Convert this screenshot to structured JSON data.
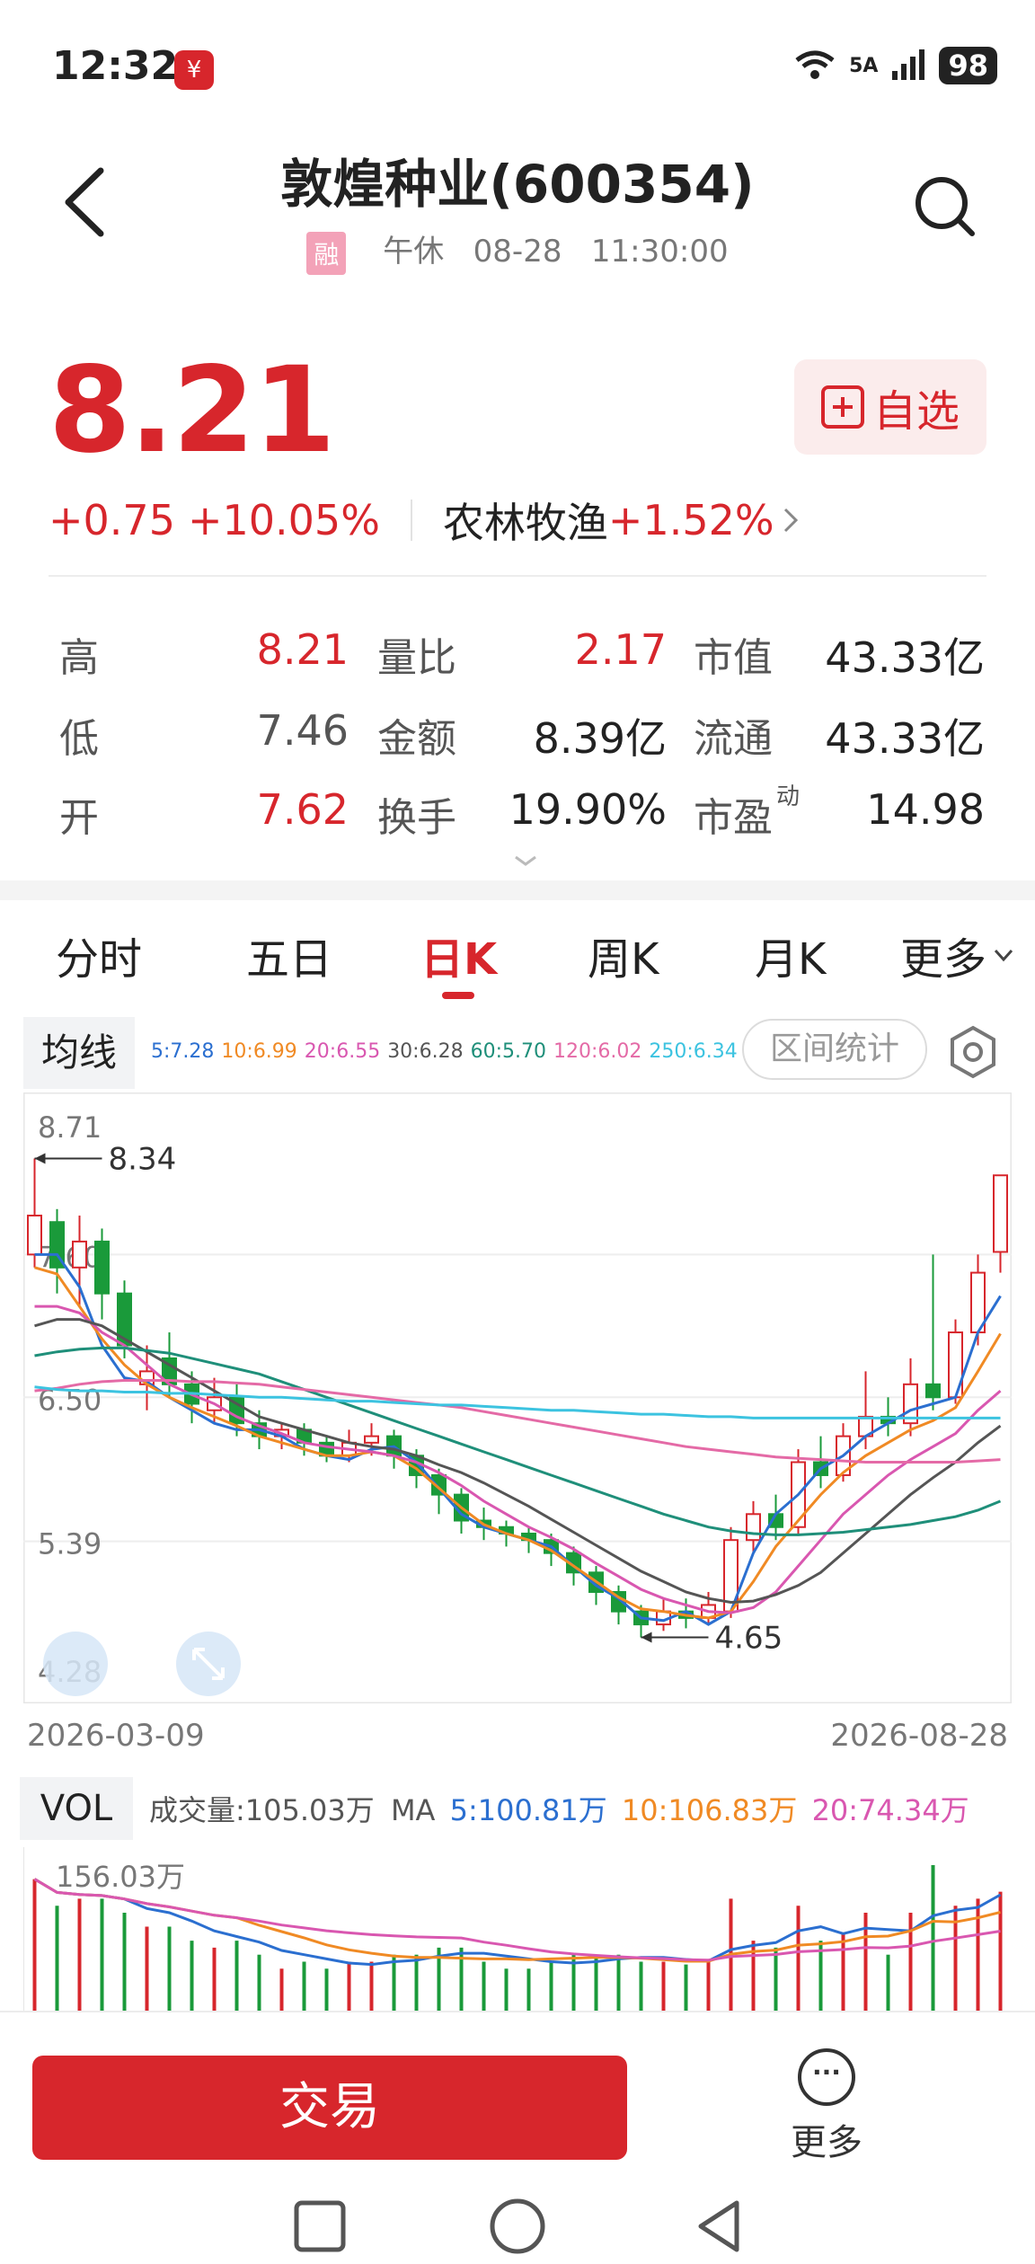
{
  "status_bar": {
    "time": "12:32",
    "network": "5A",
    "battery": "98"
  },
  "header": {
    "title": "敦煌种业(600354)",
    "margin_badge": "融",
    "session": "午休",
    "date": "08-28",
    "time": "11:30:00"
  },
  "quote": {
    "price": "8.21",
    "change": "+0.75",
    "change_pct": "+10.05%",
    "sector": "农林牧渔",
    "sector_change": "+1.52%",
    "watch_label": "自选",
    "grid": [
      [
        {
          "label": "高",
          "value": "8.21",
          "color": "red"
        },
        {
          "label": "量比",
          "value": "2.17",
          "color": "red"
        },
        {
          "label": "市值",
          "value": "43.33亿",
          "color": "black"
        }
      ],
      [
        {
          "label": "低",
          "value": "7.46",
          "color": "gray"
        },
        {
          "label": "金额",
          "value": "8.39亿",
          "color": "black"
        },
        {
          "label": "流通",
          "value": "43.33亿",
          "color": "black"
        }
      ],
      [
        {
          "label": "开",
          "value": "7.62",
          "color": "red"
        },
        {
          "label": "换手",
          "value": "19.90%",
          "color": "black"
        },
        {
          "label": "市盈",
          "sup": "动",
          "value": "14.98",
          "color": "black"
        }
      ]
    ]
  },
  "tabs": [
    "分时",
    "五日",
    "日K",
    "周K",
    "月K",
    "更多"
  ],
  "active_tab": "日K",
  "ma": {
    "label": "均线",
    "items": [
      {
        "text": "5:7.28",
        "color": "#2b6fd0"
      },
      {
        "text": "10:6.99",
        "color": "#f08a24"
      },
      {
        "text": "20:6.55",
        "color": "#d957b0"
      },
      {
        "text": "30:6.28",
        "color": "#555555"
      },
      {
        "text": "60:5.70",
        "color": "#1f8f7a"
      },
      {
        "text": "120:6.02",
        "color": "#e46aa6"
      },
      {
        "text": "250:6.34",
        "color": "#3cc3e0"
      }
    ],
    "range_stats_label": "区间统计"
  },
  "chart_data": {
    "type": "candlestick",
    "y_ticks": [
      "8.71",
      "7.60",
      "6.50",
      "5.39",
      "4.28"
    ],
    "ylim": [
      4.28,
      8.71
    ],
    "x_start": "2026-03-09",
    "x_end": "2026-08-28",
    "annotations": [
      {
        "label": "8.34",
        "kind": "high"
      },
      {
        "label": "4.65",
        "kind": "low"
      }
    ],
    "series": [
      {
        "name": "MA5",
        "color": "#2b6fd0",
        "values": [
          7.6,
          7.6,
          7.35,
          6.9,
          6.65,
          6.62,
          6.5,
          6.4,
          6.3,
          6.25,
          6.25,
          6.2,
          6.1,
          6.05,
          6.02,
          6.1,
          6.12,
          6.0,
          5.8,
          5.6,
          5.5,
          5.45,
          5.4,
          5.35,
          5.2,
          5.05,
          4.95,
          4.8,
          4.78,
          4.85,
          4.75,
          4.85,
          5.3,
          5.6,
          5.75,
          5.95,
          6.05,
          6.2,
          6.3,
          6.4,
          6.45,
          6.5,
          7.0,
          7.28
        ]
      },
      {
        "name": "MA10",
        "color": "#f08a24",
        "values": [
          7.5,
          7.45,
          7.2,
          6.95,
          6.75,
          6.6,
          6.5,
          6.42,
          6.35,
          6.28,
          6.2,
          6.15,
          6.1,
          6.05,
          6.05,
          6.08,
          6.05,
          5.95,
          5.8,
          5.65,
          5.52,
          5.45,
          5.4,
          5.32,
          5.2,
          5.08,
          4.96,
          4.87,
          4.85,
          4.82,
          4.8,
          4.85,
          5.08,
          5.35,
          5.55,
          5.75,
          5.92,
          6.05,
          6.15,
          6.25,
          6.32,
          6.42,
          6.7,
          6.99
        ]
      },
      {
        "name": "MA20",
        "color": "#d957b0",
        "values": [
          7.2,
          7.2,
          7.15,
          7.0,
          6.9,
          6.75,
          6.6,
          6.52,
          6.45,
          6.35,
          6.28,
          6.22,
          6.15,
          6.12,
          6.1,
          6.08,
          6.05,
          6.0,
          5.92,
          5.82,
          5.7,
          5.6,
          5.5,
          5.42,
          5.33,
          5.22,
          5.12,
          5.02,
          4.95,
          4.9,
          4.85,
          4.84,
          4.88,
          5.0,
          5.2,
          5.4,
          5.6,
          5.75,
          5.9,
          6.02,
          6.12,
          6.22,
          6.4,
          6.55
        ]
      },
      {
        "name": "MA30",
        "color": "#555555",
        "values": [
          7.05,
          7.1,
          7.1,
          7.05,
          6.95,
          6.85,
          6.75,
          6.65,
          6.55,
          6.45,
          6.35,
          6.3,
          6.25,
          6.2,
          6.15,
          6.12,
          6.1,
          6.05,
          5.98,
          5.92,
          5.84,
          5.75,
          5.66,
          5.56,
          5.46,
          5.36,
          5.26,
          5.16,
          5.08,
          5.0,
          4.95,
          4.92,
          4.93,
          4.98,
          5.05,
          5.15,
          5.3,
          5.45,
          5.6,
          5.75,
          5.88,
          6.0,
          6.15,
          6.28
        ]
      },
      {
        "name": "MA60",
        "color": "#1f8f7a",
        "values": [
          6.82,
          6.85,
          6.87,
          6.88,
          6.88,
          6.86,
          6.84,
          6.8,
          6.76,
          6.72,
          6.68,
          6.62,
          6.56,
          6.5,
          6.44,
          6.38,
          6.32,
          6.26,
          6.2,
          6.14,
          6.08,
          6.02,
          5.96,
          5.9,
          5.84,
          5.78,
          5.72,
          5.66,
          5.6,
          5.55,
          5.5,
          5.47,
          5.45,
          5.44,
          5.44,
          5.45,
          5.46,
          5.48,
          5.5,
          5.52,
          5.55,
          5.58,
          5.63,
          5.7
        ]
      },
      {
        "name": "MA120",
        "color": "#e46aa6",
        "values": [
          6.55,
          6.57,
          6.6,
          6.62,
          6.63,
          6.63,
          6.63,
          6.62,
          6.62,
          6.61,
          6.6,
          6.58,
          6.56,
          6.54,
          6.52,
          6.5,
          6.48,
          6.46,
          6.44,
          6.42,
          6.39,
          6.36,
          6.33,
          6.3,
          6.27,
          6.24,
          6.21,
          6.18,
          6.15,
          6.12,
          6.1,
          6.08,
          6.06,
          6.04,
          6.03,
          6.02,
          6.01,
          6.0,
          6.0,
          6.0,
          6.0,
          6.0,
          6.01,
          6.02
        ]
      },
      {
        "name": "MA250",
        "color": "#3cc3e0",
        "values": [
          6.58,
          6.56,
          6.55,
          6.55,
          6.54,
          6.54,
          6.53,
          6.53,
          6.52,
          6.51,
          6.5,
          6.5,
          6.49,
          6.48,
          6.47,
          6.47,
          6.46,
          6.45,
          6.44,
          6.44,
          6.43,
          6.42,
          6.41,
          6.4,
          6.4,
          6.39,
          6.38,
          6.37,
          6.37,
          6.36,
          6.35,
          6.35,
          6.34,
          6.34,
          6.34,
          6.34,
          6.34,
          6.34,
          6.34,
          6.34,
          6.34,
          6.34,
          6.34,
          6.34
        ]
      }
    ],
    "candles": [
      [
        7.6,
        7.9,
        8.34,
        7.5
      ],
      [
        7.85,
        7.5,
        7.95,
        7.3
      ],
      [
        7.5,
        7.7,
        7.9,
        7.2
      ],
      [
        7.7,
        7.3,
        7.8,
        7.1
      ],
      [
        7.3,
        6.9,
        7.4,
        6.8
      ],
      [
        6.6,
        6.7,
        6.9,
        6.4
      ],
      [
        6.8,
        6.6,
        7.0,
        6.5
      ],
      [
        6.6,
        6.45,
        6.7,
        6.3
      ],
      [
        6.4,
        6.5,
        6.65,
        6.3
      ],
      [
        6.5,
        6.3,
        6.6,
        6.2
      ],
      [
        6.3,
        6.2,
        6.4,
        6.1
      ],
      [
        6.2,
        6.25,
        6.3,
        6.1
      ],
      [
        6.25,
        6.15,
        6.3,
        6.05
      ],
      [
        6.15,
        6.05,
        6.2,
        6.0
      ],
      [
        6.05,
        6.15,
        6.25,
        6.0
      ],
      [
        6.15,
        6.2,
        6.3,
        6.05
      ],
      [
        6.2,
        6.05,
        6.25,
        5.95
      ],
      [
        6.05,
        5.9,
        6.1,
        5.8
      ],
      [
        5.9,
        5.75,
        5.95,
        5.6
      ],
      [
        5.75,
        5.55,
        5.8,
        5.45
      ],
      [
        5.55,
        5.5,
        5.65,
        5.4
      ],
      [
        5.5,
        5.45,
        5.55,
        5.35
      ],
      [
        5.45,
        5.4,
        5.5,
        5.3
      ],
      [
        5.4,
        5.3,
        5.45,
        5.2
      ],
      [
        5.3,
        5.15,
        5.35,
        5.05
      ],
      [
        5.15,
        5.0,
        5.2,
        4.9
      ],
      [
        5.0,
        4.85,
        5.05,
        4.75
      ],
      [
        4.85,
        4.75,
        4.9,
        4.65
      ],
      [
        4.75,
        4.85,
        4.95,
        4.7
      ],
      [
        4.85,
        4.8,
        4.95,
        4.72
      ],
      [
        4.8,
        4.9,
        5.0,
        4.75
      ],
      [
        4.85,
        5.4,
        5.5,
        4.8
      ],
      [
        5.4,
        5.6,
        5.7,
        5.3
      ],
      [
        5.6,
        5.5,
        5.75,
        5.4
      ],
      [
        5.5,
        6.0,
        6.1,
        5.45
      ],
      [
        6.0,
        5.9,
        6.2,
        5.8
      ],
      [
        5.9,
        6.2,
        6.3,
        5.85
      ],
      [
        6.2,
        6.35,
        6.7,
        6.1
      ],
      [
        6.35,
        6.3,
        6.5,
        6.2
      ],
      [
        6.3,
        6.6,
        6.8,
        6.2
      ],
      [
        6.6,
        6.5,
        7.6,
        6.4
      ],
      [
        6.5,
        7.0,
        7.1,
        6.45
      ],
      [
        7.0,
        7.46,
        7.6,
        6.9
      ],
      [
        7.62,
        8.21,
        8.21,
        7.46
      ]
    ]
  },
  "vol": {
    "label": "VOL",
    "text": "成交量:105.03万",
    "ma_label": "MA",
    "ma5": "5:100.81万",
    "ma10": "10:106.83万",
    "ma20": "20:74.34万",
    "max_label": "156.03万",
    "colors": {
      "ma5": "#2b6fd0",
      "ma10": "#f08a24",
      "ma20": "#d957b0"
    }
  },
  "bottom": {
    "trade_label": "交易",
    "more_label": "更多"
  },
  "colors": {
    "up": "#d7262c",
    "down": "#1a9a3a"
  }
}
